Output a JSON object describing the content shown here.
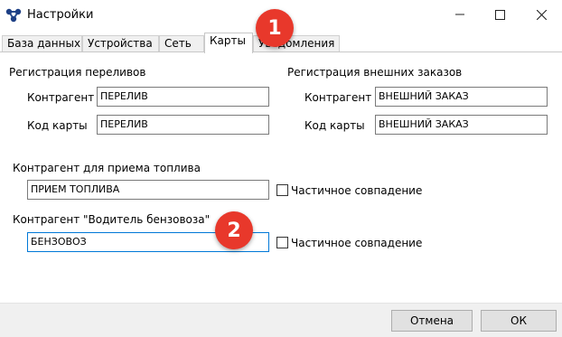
{
  "window": {
    "title": "Настройки",
    "icons": {
      "app": "network-icon",
      "minimize": "minimize-icon",
      "maximize": "maximize-icon",
      "close": "close-icon"
    }
  },
  "tabs": [
    {
      "label": "База данных",
      "active": false
    },
    {
      "label": "Устройства",
      "active": false
    },
    {
      "label": "Сеть",
      "active": false
    },
    {
      "label": "Карты",
      "active": true
    },
    {
      "label": "Уведомления",
      "active": false
    }
  ],
  "overflow_registration": {
    "heading": "Регистрация переливов",
    "counterparty_label": "Контрагент",
    "counterparty_value": "ПЕРЕЛИВ",
    "card_code_label": "Код карты",
    "card_code_value": "ПЕРЕЛИВ"
  },
  "external_orders": {
    "heading": "Регистрация внешних заказов",
    "counterparty_label": "Контрагент",
    "counterparty_value": "ВНЕШНИЙ ЗАКАЗ",
    "card_code_label": "Код карты",
    "card_code_value": "ВНЕШНИЙ ЗАКАЗ"
  },
  "fuel_receipt": {
    "label": "Контрагент для приема топлива",
    "value": "ПРИЕМ ТОПЛИВА",
    "partial_match_label": "Частичное совпадение",
    "partial_match_checked": false
  },
  "tanker_driver": {
    "label": "Контрагент \"Водитель бензовоза\"",
    "value": "БЕНЗОВОЗ",
    "partial_match_label": "Частичное совпадение",
    "partial_match_checked": false
  },
  "badges": [
    "1",
    "2"
  ],
  "badge_color": "#e8382b",
  "buttons": {
    "cancel": "Отмена",
    "ok": "ОК"
  }
}
